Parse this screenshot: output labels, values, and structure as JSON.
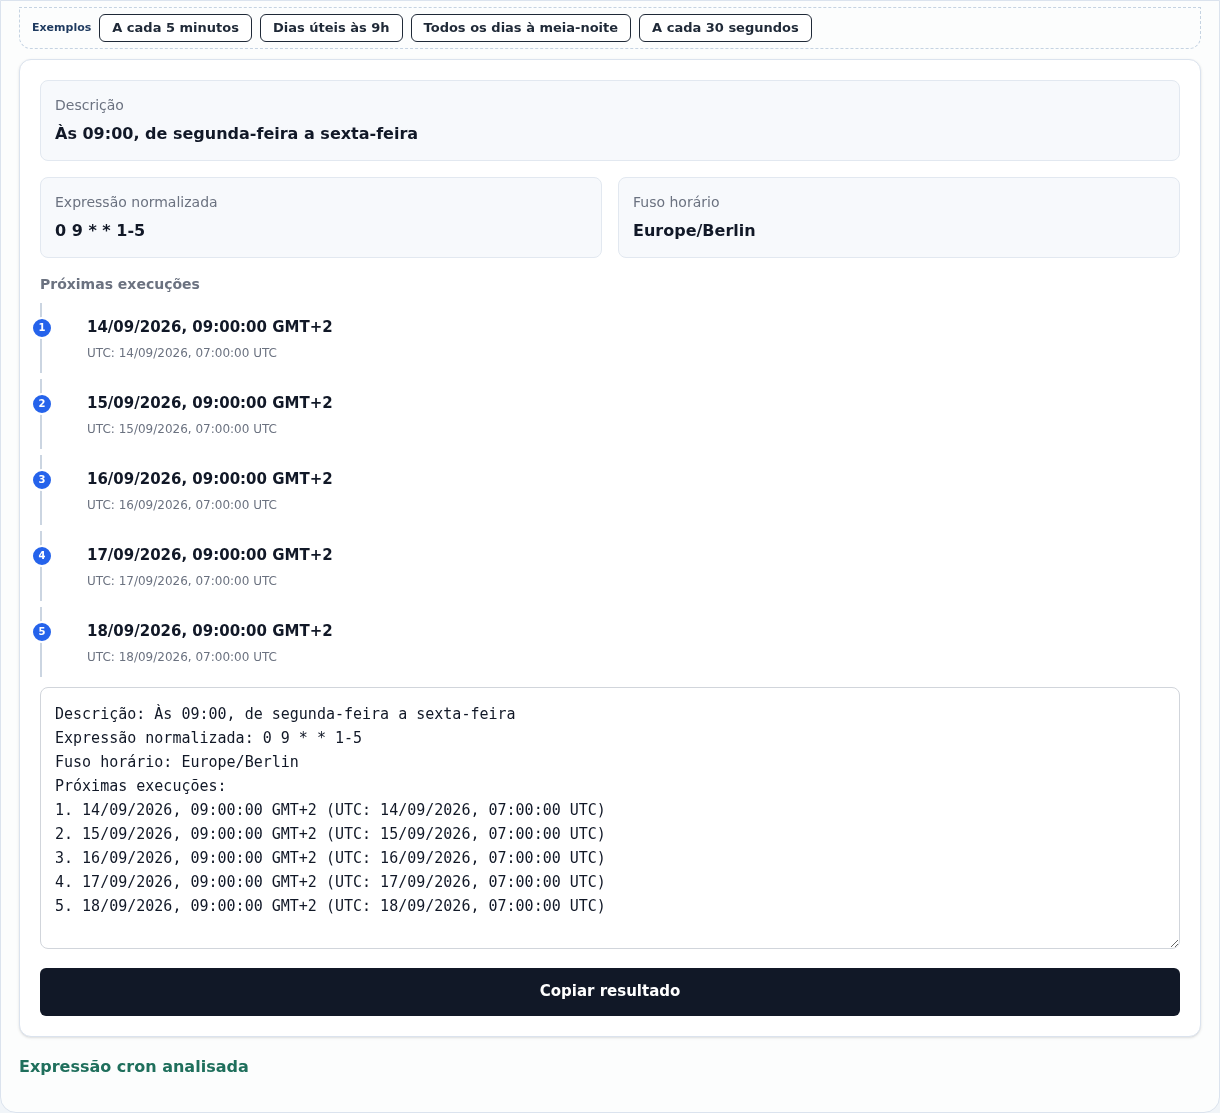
{
  "examples": {
    "label": "Exemplos",
    "buttons": [
      "A cada 5 minutos",
      "Dias úteis às 9h",
      "Todos os dias à meia-noite",
      "A cada 30 segundos"
    ]
  },
  "description": {
    "label": "Descrição",
    "value": "Às 09:00, de segunda-feira a sexta-feira"
  },
  "normalized": {
    "label": "Expressão normalizada",
    "value": "0 9 * * 1-5"
  },
  "timezone": {
    "label": "Fuso horário",
    "value": "Europe/Berlin"
  },
  "runs": {
    "title": "Próximas execuções",
    "items": [
      {
        "index": "1",
        "local": "14/09/2026, 09:00:00 GMT+2",
        "utc": "UTC: 14/09/2026, 07:00:00 UTC"
      },
      {
        "index": "2",
        "local": "15/09/2026, 09:00:00 GMT+2",
        "utc": "UTC: 15/09/2026, 07:00:00 UTC"
      },
      {
        "index": "3",
        "local": "16/09/2026, 09:00:00 GMT+2",
        "utc": "UTC: 16/09/2026, 07:00:00 UTC"
      },
      {
        "index": "4",
        "local": "17/09/2026, 09:00:00 GMT+2",
        "utc": "UTC: 17/09/2026, 07:00:00 UTC"
      },
      {
        "index": "5",
        "local": "18/09/2026, 09:00:00 GMT+2",
        "utc": "UTC: 18/09/2026, 07:00:00 UTC"
      }
    ]
  },
  "output": {
    "lines": [
      "Descrição: Às 09:00, de segunda-feira a sexta-feira",
      "Expressão normalizada: 0 9 * * 1-5",
      "Fuso horário: Europe/Berlin",
      "Próximas execuções:",
      "1. 14/09/2026, 09:00:00 GMT+2 (UTC: 14/09/2026, 07:00:00 UTC)",
      "2. 15/09/2026, 09:00:00 GMT+2 (UTC: 15/09/2026, 07:00:00 UTC)",
      "3. 16/09/2026, 09:00:00 GMT+2 (UTC: 16/09/2026, 07:00:00 UTC)",
      "4. 17/09/2026, 09:00:00 GMT+2 (UTC: 17/09/2026, 07:00:00 UTC)",
      "5. 18/09/2026, 09:00:00 GMT+2 (UTC: 18/09/2026, 07:00:00 UTC)"
    ]
  },
  "copy_button": "Copiar resultado",
  "status": "Expressão cron analisada"
}
